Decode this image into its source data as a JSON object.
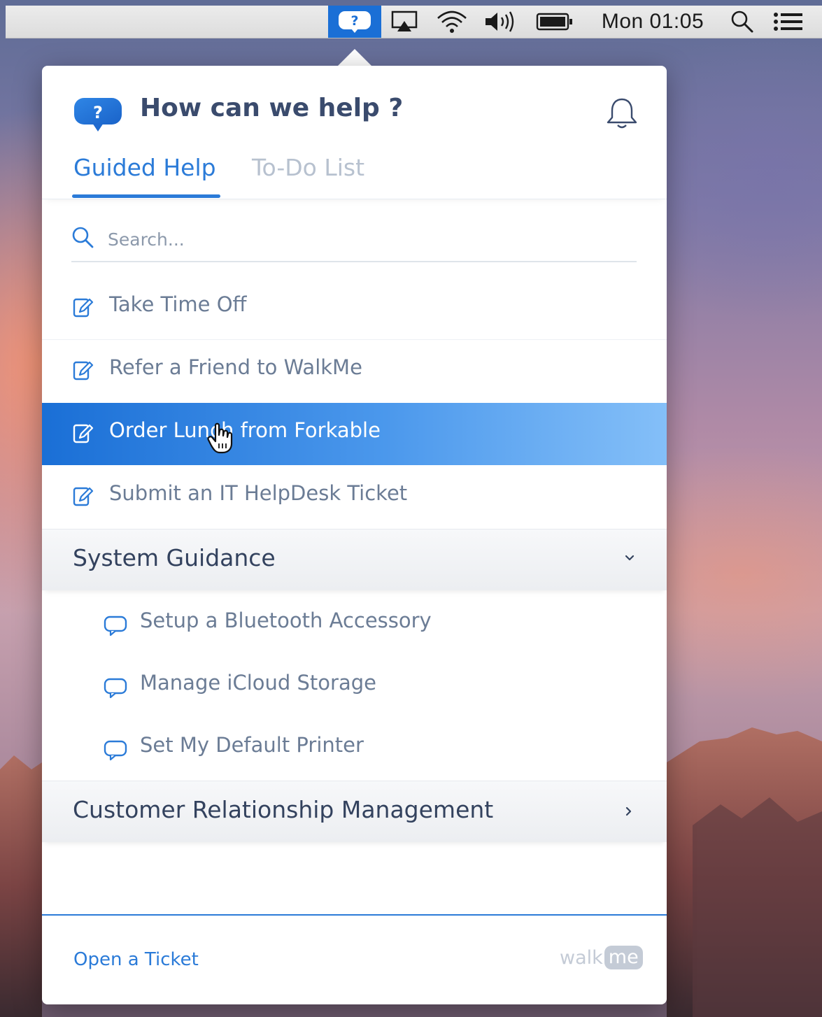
{
  "menubar": {
    "clock": "Mon 01:05",
    "help_icon_glyph": "?"
  },
  "panel": {
    "header": {
      "title": "How can we help ?",
      "bubble_glyph": "?"
    },
    "tabs": [
      {
        "label": "Guided Help",
        "active": true
      },
      {
        "label": "To-Do List",
        "active": false
      }
    ],
    "search": {
      "placeholder": "Search...",
      "value": ""
    },
    "items": [
      {
        "label": "Take Time Off",
        "icon": "edit-icon"
      },
      {
        "label": "Refer a Friend to WalkMe",
        "icon": "edit-icon"
      },
      {
        "label": "Order Lunch from Forkable",
        "icon": "edit-icon",
        "highlighted": true
      },
      {
        "label": "Submit an IT HelpDesk Ticket",
        "icon": "edit-icon"
      }
    ],
    "categories": [
      {
        "label": "System Guidance",
        "expanded": true,
        "items": [
          {
            "label": "Setup a Bluetooth Accessory",
            "icon": "speech-bubble-icon"
          },
          {
            "label": "Manage iCloud Storage",
            "icon": "speech-bubble-icon"
          },
          {
            "label": "Set My Default Printer",
            "icon": "speech-bubble-icon"
          }
        ]
      },
      {
        "label": "Customer Relationship Management",
        "expanded": false
      }
    ],
    "footer": {
      "link": "Open a Ticket",
      "brand_walk": "walk",
      "brand_me": "me"
    }
  },
  "colors": {
    "accent": "#2b7bd8",
    "highlight_start": "#1a6fd6",
    "highlight_end": "#84bff8",
    "text_muted": "#6b7c95",
    "tab_inactive": "#b7c1cf"
  }
}
